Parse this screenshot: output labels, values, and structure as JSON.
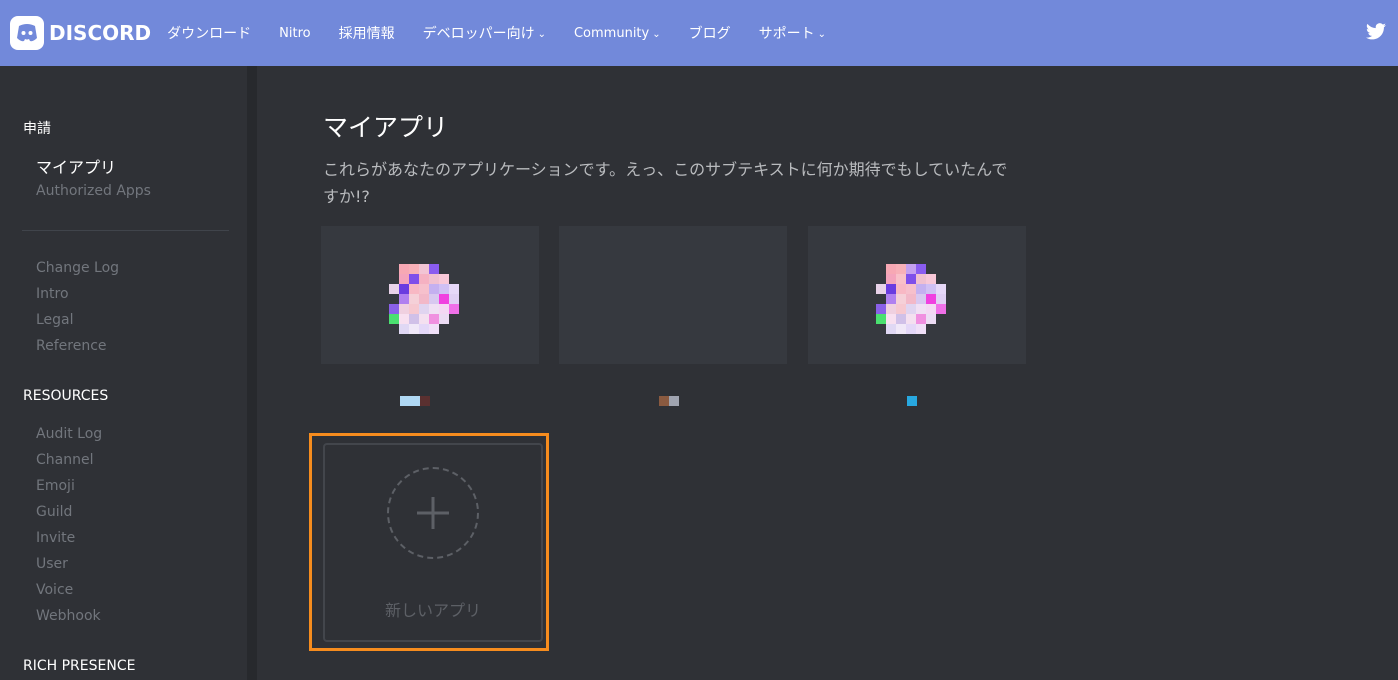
{
  "nav": {
    "logo_text": "DISCORD",
    "links": [
      {
        "label": "ダウンロード",
        "dropdown": false
      },
      {
        "label": "Nitro",
        "dropdown": false
      },
      {
        "label": "採用情報",
        "dropdown": false
      },
      {
        "label": "デベロッパー向け",
        "dropdown": true
      },
      {
        "label": "Community",
        "dropdown": true
      },
      {
        "label": "ブログ",
        "dropdown": false
      },
      {
        "label": "サポート",
        "dropdown": true
      }
    ],
    "twitter_icon": "twitter-icon",
    "bg_color": "#7289da"
  },
  "sidebar": {
    "section_applications": "申請",
    "my_apps": "マイアプリ",
    "authorized_apps": "Authorized Apps",
    "docs": [
      "Change Log",
      "Intro",
      "Legal",
      "Reference"
    ],
    "resources_heading": "RESOURCES",
    "resources": [
      "Audit Log",
      "Channel",
      "Emoji",
      "Guild",
      "Invite",
      "User",
      "Voice",
      "Webhook"
    ],
    "rich_presence_heading": "RICH PRESENCE"
  },
  "main": {
    "title": "マイアプリ",
    "subtitle": "これらがあなたのアプリケーションです。えっ、このサブテキストに何か期待でもしていたんですか!?",
    "new_app_label": "新しいアプリ",
    "highlight_color": "#f68c1e"
  }
}
